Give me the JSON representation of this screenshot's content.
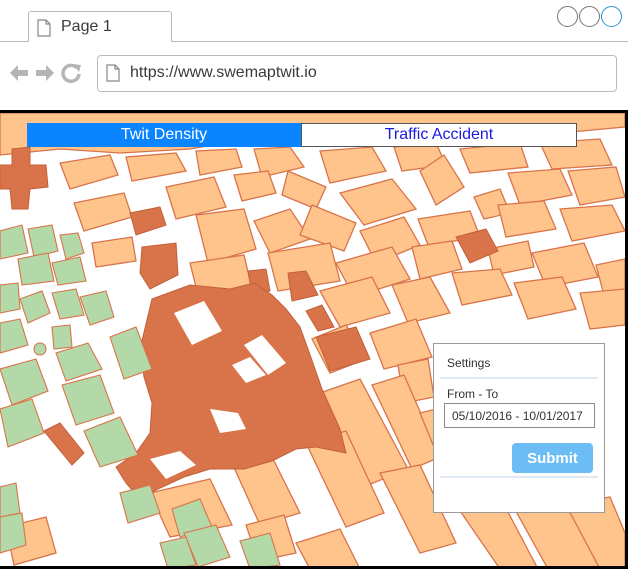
{
  "browser": {
    "tab_title": "Page 1",
    "url": "https://www.swemaptwit.io",
    "window_controls": [
      "minimize-icon",
      "maximize-icon",
      "close-icon"
    ],
    "nav_icons": [
      "back-arrow-icon",
      "forward-arrow-icon",
      "reload-icon"
    ]
  },
  "map_tabs": [
    {
      "label": "Twit Density",
      "active": true
    },
    {
      "label": "Traffic Accident",
      "active": false
    }
  ],
  "settings": {
    "title": "Settings",
    "range_label": "From - To",
    "range_value": "05/10/2016 - 10/01/2017",
    "submit_label": "Submit"
  },
  "colors": {
    "active_tab": "#0a84ff",
    "inactive_tab_text": "#1a1ae0",
    "submit": "#6cbcf6",
    "building_light": "#ffc48b",
    "building_dark": "#d9734a",
    "park": "#b3d9a8"
  }
}
